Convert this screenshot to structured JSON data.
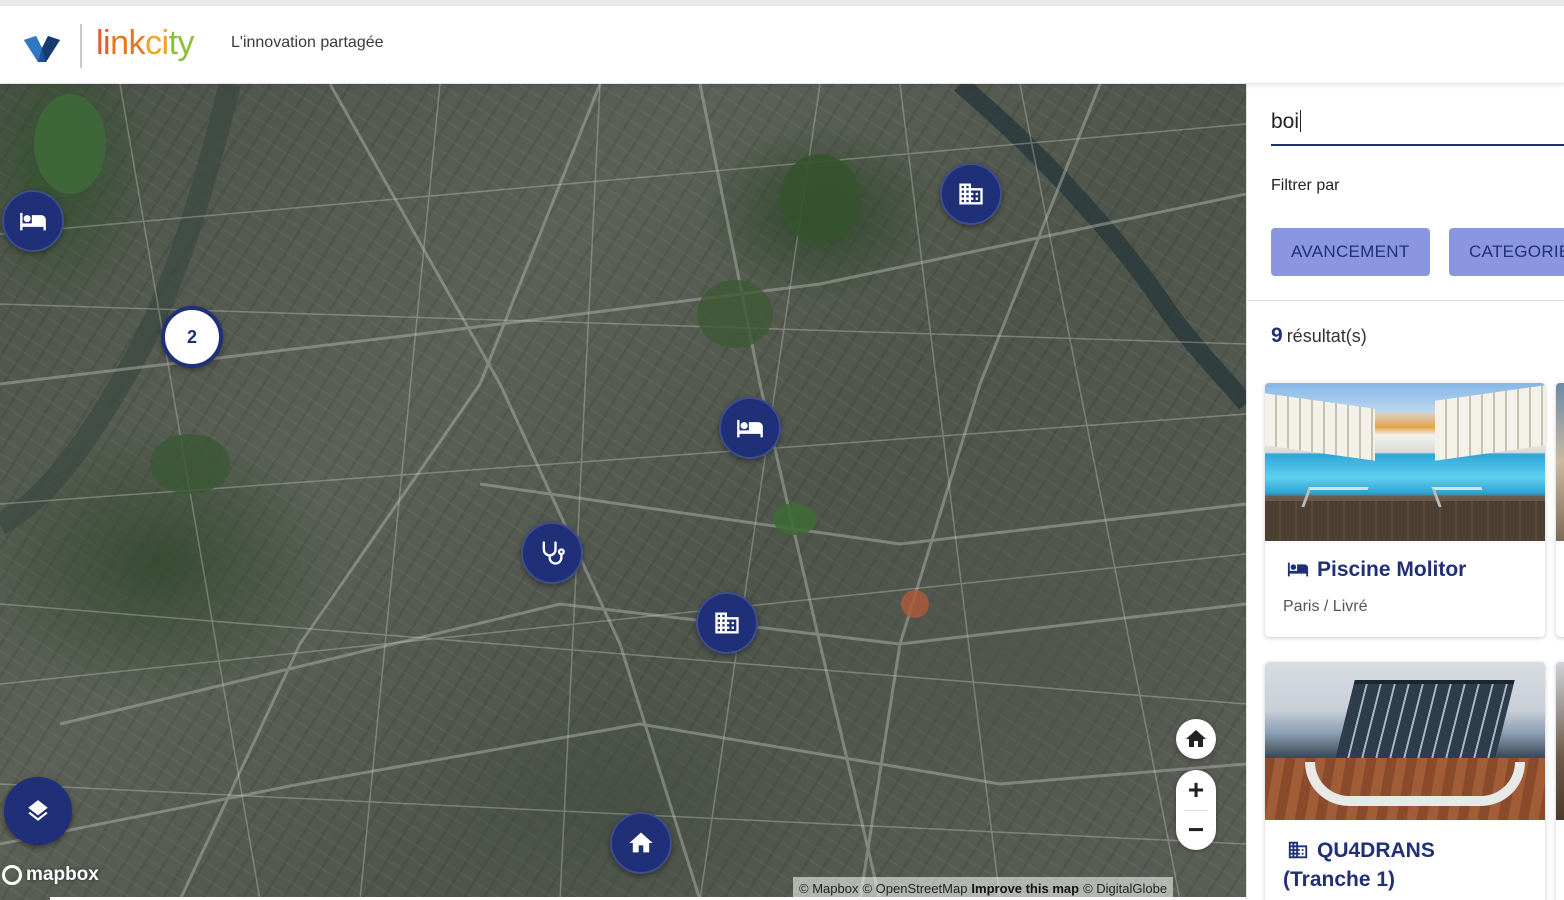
{
  "header": {
    "brand": {
      "part1": "li",
      "part2": "nk",
      "part3": "ci",
      "part4": "ty"
    },
    "tagline": "L'innovation partagée"
  },
  "map": {
    "cluster_count": "2",
    "markers": [
      {
        "type": "hotel",
        "icon": "bed-icon"
      },
      {
        "type": "office",
        "icon": "building-icon"
      },
      {
        "type": "hotel",
        "icon": "bed-icon"
      },
      {
        "type": "health",
        "icon": "stethoscope-icon"
      },
      {
        "type": "office",
        "icon": "building-icon"
      },
      {
        "type": "housing",
        "icon": "home-icon"
      }
    ],
    "controls": {
      "zoom_in": "+",
      "zoom_out": "−"
    },
    "mapbox_logo": "mapbox",
    "attribution": {
      "mapbox": "© Mapbox",
      "osm": "© OpenStreetMap",
      "improve": "Improve this map",
      "digitalglobe": "© DigitalGlobe"
    }
  },
  "panel": {
    "search_value": "boi",
    "filter_label": "Filtrer par",
    "filters": [
      "AVANCEMENT",
      "CATEGORIE"
    ],
    "results_count": "9",
    "results_label": "résultat(s)",
    "cards": [
      {
        "title": "Piscine Molitor",
        "subtitle": "Paris / Livré",
        "icon": "bed-icon"
      },
      {
        "title_line1": "QU4DRANS",
        "title_line2": "(Tranche 1)",
        "icon": "building-icon"
      }
    ]
  },
  "colors": {
    "primary": "#1f2f78",
    "chip": "#8a97e0",
    "brand_orange": "#e8761b"
  }
}
